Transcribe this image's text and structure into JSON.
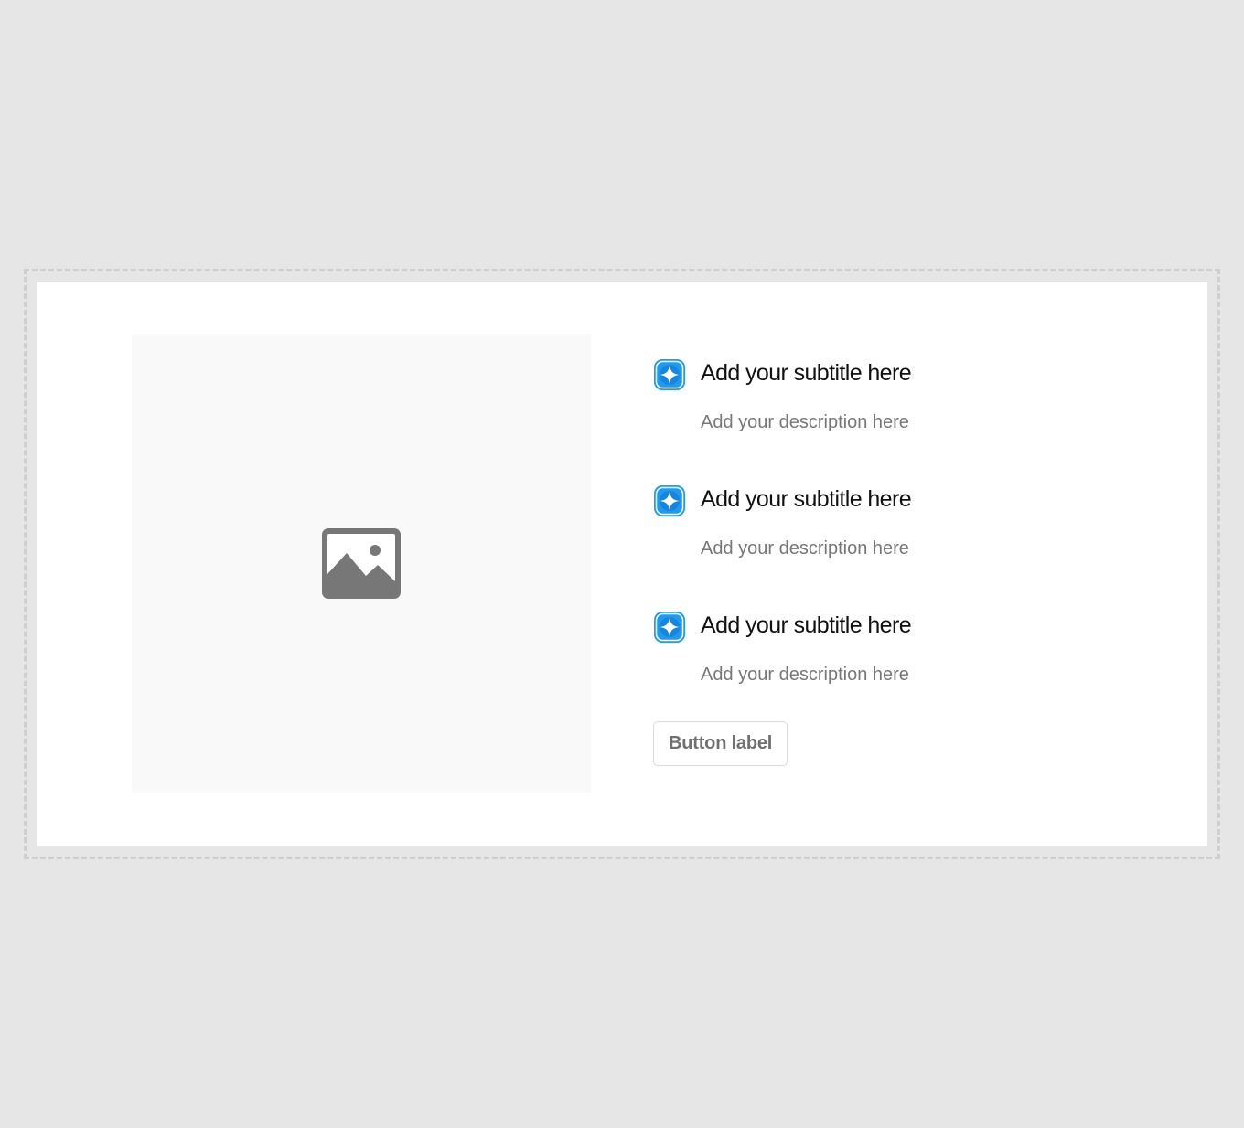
{
  "colors": {
    "page_background": "#e6e6e6",
    "card_background": "#ffffff",
    "accent": "#1e9bf0",
    "placeholder": "#777777"
  },
  "media": {
    "icon": "image-icon"
  },
  "features": [
    {
      "icon": "sparkle-icon",
      "subtitle": "Add your subtitle here",
      "description": "Add your description here"
    },
    {
      "icon": "sparkle-icon",
      "subtitle": "Add your subtitle here",
      "description": "Add your description here"
    },
    {
      "icon": "sparkle-icon",
      "subtitle": "Add your subtitle here",
      "description": "Add your description here"
    }
  ],
  "button": {
    "label": "Button label"
  }
}
